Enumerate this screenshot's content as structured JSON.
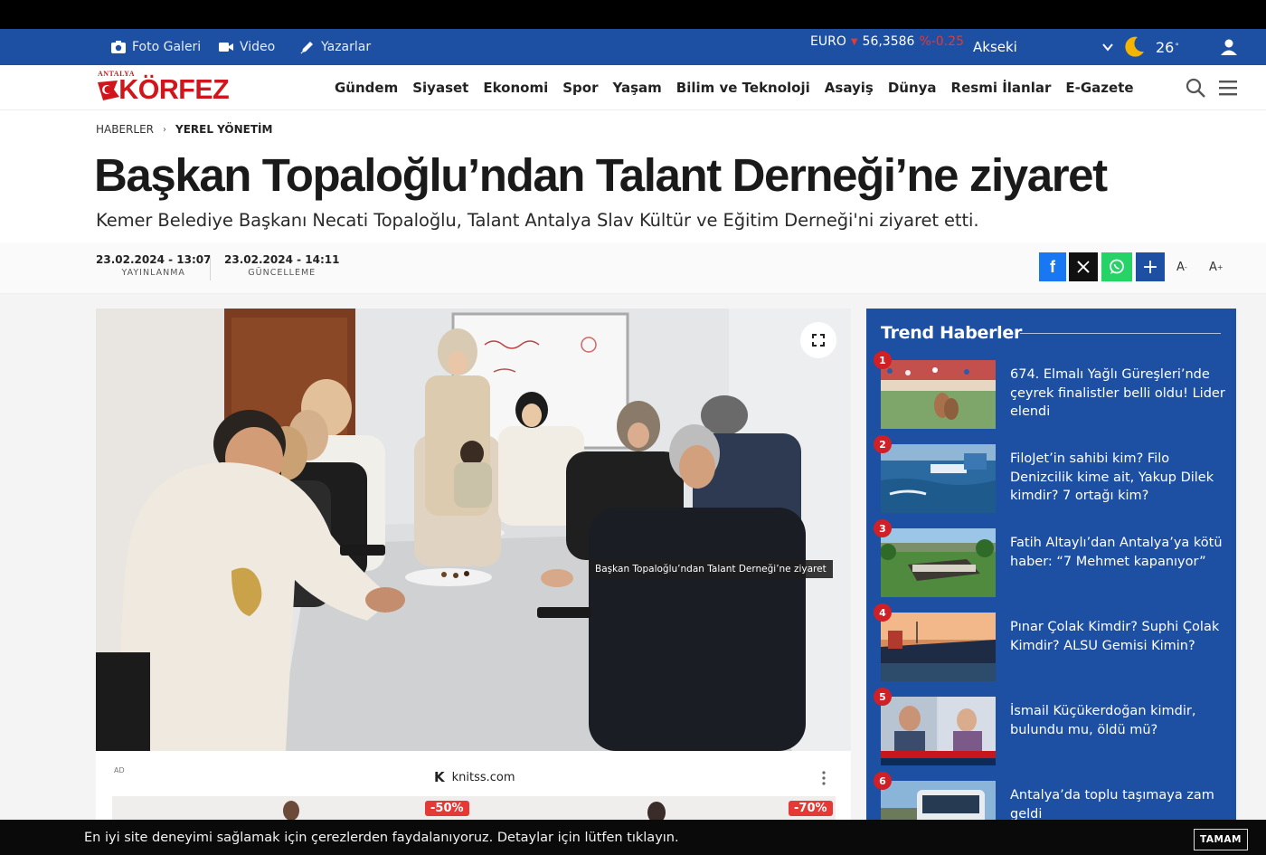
{
  "topbar": {
    "links": [
      {
        "label": "Foto Galeri",
        "icon": "camera-icon"
      },
      {
        "label": "Video",
        "icon": "video-icon"
      },
      {
        "label": "Yazarlar",
        "icon": "pen-icon"
      }
    ],
    "currency": {
      "name": "EURO",
      "value": "56,3586",
      "change": "%-0.25"
    },
    "city": "Akseki",
    "temperature": "26",
    "temperature_unit": "°"
  },
  "brand": {
    "logo_small": "ANTALYA",
    "logo_big": "KÖRFEZ",
    "red": "#d0161c"
  },
  "nav": {
    "items": [
      "Gündem",
      "Siyaset",
      "Ekonomi",
      "Spor",
      "Yaşam",
      "Bilim ve Teknoloji",
      "Asayiş",
      "Dünya",
      "Resmi İlanlar",
      "E-Gazete"
    ]
  },
  "breadcrumb": {
    "home": "HABERLER",
    "separator": "›",
    "current": "YEREL YÖNETİM"
  },
  "article": {
    "title": "Başkan Topaloğlu’ndan Talant Derneği’ne ziyaret",
    "subtitle": "Kemer Belediye Başkanı Necati Topaloğlu, Talant Antalya Slav Kültür ve Eğitim Derneği'ni ziyaret etti.",
    "published_date": "23.02.2024 - 13:07",
    "published_label": "YAYINLANMA",
    "updated_date": "23.02.2024 - 14:11",
    "updated_label": "GÜNCELLEME",
    "photo_caption": "Başkan Topaloğlu’ndan Talant Derneği’ne ziyaret"
  },
  "share": {
    "facebook": "f",
    "plus": "+",
    "font_down": "A",
    "font_down_sup": "-",
    "font_up": "A",
    "font_up_sup": "+"
  },
  "ad": {
    "label": "AD",
    "domain": "knitss.com",
    "logo": "K",
    "discount_1": "-50%",
    "discount_2": "-70%"
  },
  "trend": {
    "title": "Trend Haberler",
    "items": [
      {
        "rank": "1",
        "text": "674. Elmalı Yağlı Güreşleri’nde çeyrek finalistler belli oldu! Lider elendi"
      },
      {
        "rank": "2",
        "text": "FiloJet’in sahibi kim? Filo Denizcilik kime ait, Yakup Dilek kimdir? 7 ortağı kim?"
      },
      {
        "rank": "3",
        "text": "Fatih Altaylı’dan Antalya’ya kötü haber: “7 Mehmet kapanıyor”"
      },
      {
        "rank": "4",
        "text": "Pınar Çolak Kimdir? Suphi Çolak Kimdir? ALSU Gemisi Kimin?"
      },
      {
        "rank": "5",
        "text": "İsmail Küçükerdoğan kimdir, bulundu mu, öldü mü?"
      },
      {
        "rank": "6",
        "text": "Antalya’da toplu taşımaya zam geldi"
      }
    ]
  },
  "cookie": {
    "text": "En iyi site deneyimi sağlamak için çerezlerden faydalanıyoruz. Detaylar için lütfen tıklayın.",
    "button": "TAMAM"
  },
  "colors": {
    "topbar": "#1d4fa3",
    "sidebar": "#1d4fa3",
    "facebook": "#1877f2",
    "whatsapp": "#25d366",
    "accent_red": "#d01f26"
  }
}
